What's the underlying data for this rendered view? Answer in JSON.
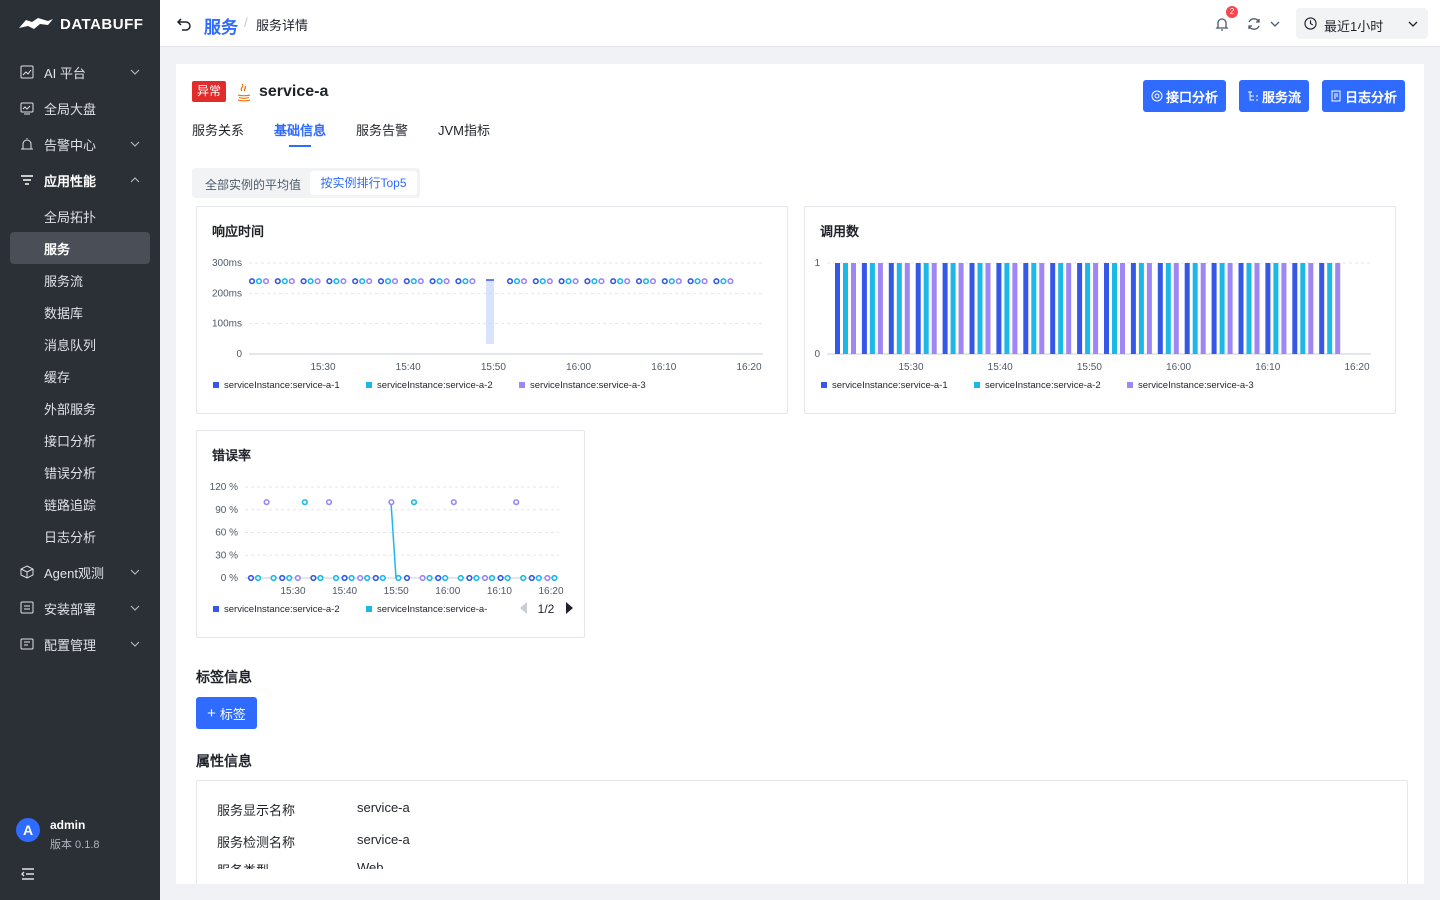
{
  "app": {
    "brand": "DATABUFF"
  },
  "sidebar": {
    "items": [
      {
        "label": "AI 平台",
        "icon": "chart-line-icon",
        "expandable": true
      },
      {
        "label": "全局大盘",
        "icon": "dashboard-icon",
        "expandable": false
      },
      {
        "label": "告警中心",
        "icon": "alarm-icon",
        "expandable": true
      },
      {
        "label": "应用性能",
        "icon": "list-filter-icon",
        "expandable": true,
        "expanded": true
      },
      {
        "label": "全局拓扑"
      },
      {
        "label": "服务",
        "active": true
      },
      {
        "label": "服务流"
      },
      {
        "label": "数据库"
      },
      {
        "label": "消息队列"
      },
      {
        "label": "缓存"
      },
      {
        "label": "外部服务"
      },
      {
        "label": "接口分析"
      },
      {
        "label": "错误分析"
      },
      {
        "label": "链路追踪"
      },
      {
        "label": "日志分析"
      },
      {
        "label": "Agent观测",
        "icon": "cube-icon",
        "expandable": true
      },
      {
        "label": "安装部署",
        "icon": "install-icon",
        "expandable": true
      },
      {
        "label": "配置管理",
        "icon": "settings-list-icon",
        "expandable": true
      }
    ],
    "user": {
      "avatar_letter": "A",
      "name": "admin",
      "version": "版本 0.1.8"
    }
  },
  "header": {
    "breadcrumb_root": "服务",
    "breadcrumb_sep": "/",
    "breadcrumb_current": "服务详情",
    "notification_count": "2",
    "time_range": "最近1小时"
  },
  "service": {
    "status_tag": "异常",
    "name": "service-a",
    "language_icon": "java-icon",
    "actions": [
      "接口分析",
      "服务流",
      "日志分析"
    ],
    "tabs": [
      "服务关系",
      "基础信息",
      "服务告警",
      "JVM指标"
    ],
    "active_tab": "基础信息",
    "segment_options": [
      "全部实例的平均值",
      "按实例排行Top5"
    ],
    "active_segment": "按实例排行Top5"
  },
  "colors": {
    "primary": "#2f6bff",
    "series1": "#3658e6",
    "series2": "#1cb8e8",
    "series3": "#9e86f5",
    "danger": "#e22b2b"
  },
  "chart_data": [
    {
      "type": "scatter",
      "title": "响应时间",
      "x_ticks": [
        "15:30",
        "15:40",
        "15:50",
        "16:00",
        "16:10",
        "16:20"
      ],
      "y_ticks": [
        "300ms",
        "200ms",
        "100ms",
        "0"
      ],
      "ylim": [
        0,
        300
      ],
      "series": [
        {
          "name": "serviceInstance:service-a-1",
          "values": [
            240,
            240,
            240,
            240,
            240,
            240,
            240,
            240,
            240,
            240,
            240,
            240,
            240,
            240,
            240,
            240,
            240,
            240,
            240
          ]
        },
        {
          "name": "serviceInstance:service-a-2",
          "values": [
            240,
            240,
            240,
            240,
            240,
            240,
            240,
            240,
            240,
            240,
            240,
            240,
            240,
            240,
            240,
            240,
            240,
            240,
            240
          ]
        },
        {
          "name": "serviceInstance:service-a-3",
          "values": [
            240,
            240,
            240,
            240,
            240,
            240,
            240,
            240,
            240,
            240,
            240,
            240,
            240,
            240,
            240,
            240,
            240,
            240,
            240
          ]
        }
      ],
      "annotations": [
        "spike near 15:50"
      ]
    },
    {
      "type": "bar",
      "title": "调用数",
      "x_ticks": [
        "15:30",
        "15:40",
        "15:50",
        "16:00",
        "16:10",
        "16:20"
      ],
      "y_ticks": [
        "1",
        "0"
      ],
      "ylim": [
        0,
        1
      ],
      "series": [
        {
          "name": "serviceInstance:service-a-1",
          "values": [
            1,
            1,
            1,
            1,
            1,
            1,
            1,
            1,
            1,
            1,
            1,
            1,
            1,
            1,
            1,
            1,
            1,
            1,
            1
          ]
        },
        {
          "name": "serviceInstance:service-a-2",
          "values": [
            1,
            1,
            1,
            1,
            1,
            1,
            1,
            1,
            1,
            1,
            1,
            1,
            1,
            1,
            1,
            1,
            1,
            1,
            1
          ]
        },
        {
          "name": "serviceInstance:service-a-3",
          "values": [
            1,
            1,
            1,
            1,
            1,
            1,
            1,
            1,
            1,
            1,
            1,
            1,
            1,
            1,
            1,
            1,
            1,
            1,
            1
          ]
        }
      ]
    },
    {
      "type": "scatter",
      "title": "错误率",
      "x_ticks": [
        "15:30",
        "15:40",
        "15:50",
        "16:00",
        "16:10",
        "16:20"
      ],
      "y_ticks": [
        "120 %",
        "90 %",
        "60 %",
        "30 %",
        "0 %"
      ],
      "ylim": [
        0,
        120
      ],
      "series": [
        {
          "name": "serviceInstance:service-a-2",
          "values": [
            0,
            100,
            0,
            0,
            0,
            100,
            0,
            0,
            0,
            100,
            0,
            0,
            0,
            100,
            0,
            0,
            0,
            100,
            0,
            0
          ]
        },
        {
          "name": "serviceInstance:service-a-",
          "values": [
            0,
            0,
            0,
            100,
            0,
            0,
            0,
            0,
            0,
            0,
            100,
            0,
            0,
            0,
            0,
            0,
            0,
            0,
            0,
            0
          ]
        }
      ],
      "legend_page": "1/2"
    }
  ],
  "tag_section": {
    "title": "标签信息",
    "add_label": "标签"
  },
  "attr_section": {
    "title": "属性信息",
    "rows": [
      {
        "key": "服务显示名称",
        "value": "service-a"
      },
      {
        "key": "服务检测名称",
        "value": "service-a"
      },
      {
        "key": "服务类型",
        "value": "Web"
      }
    ]
  }
}
